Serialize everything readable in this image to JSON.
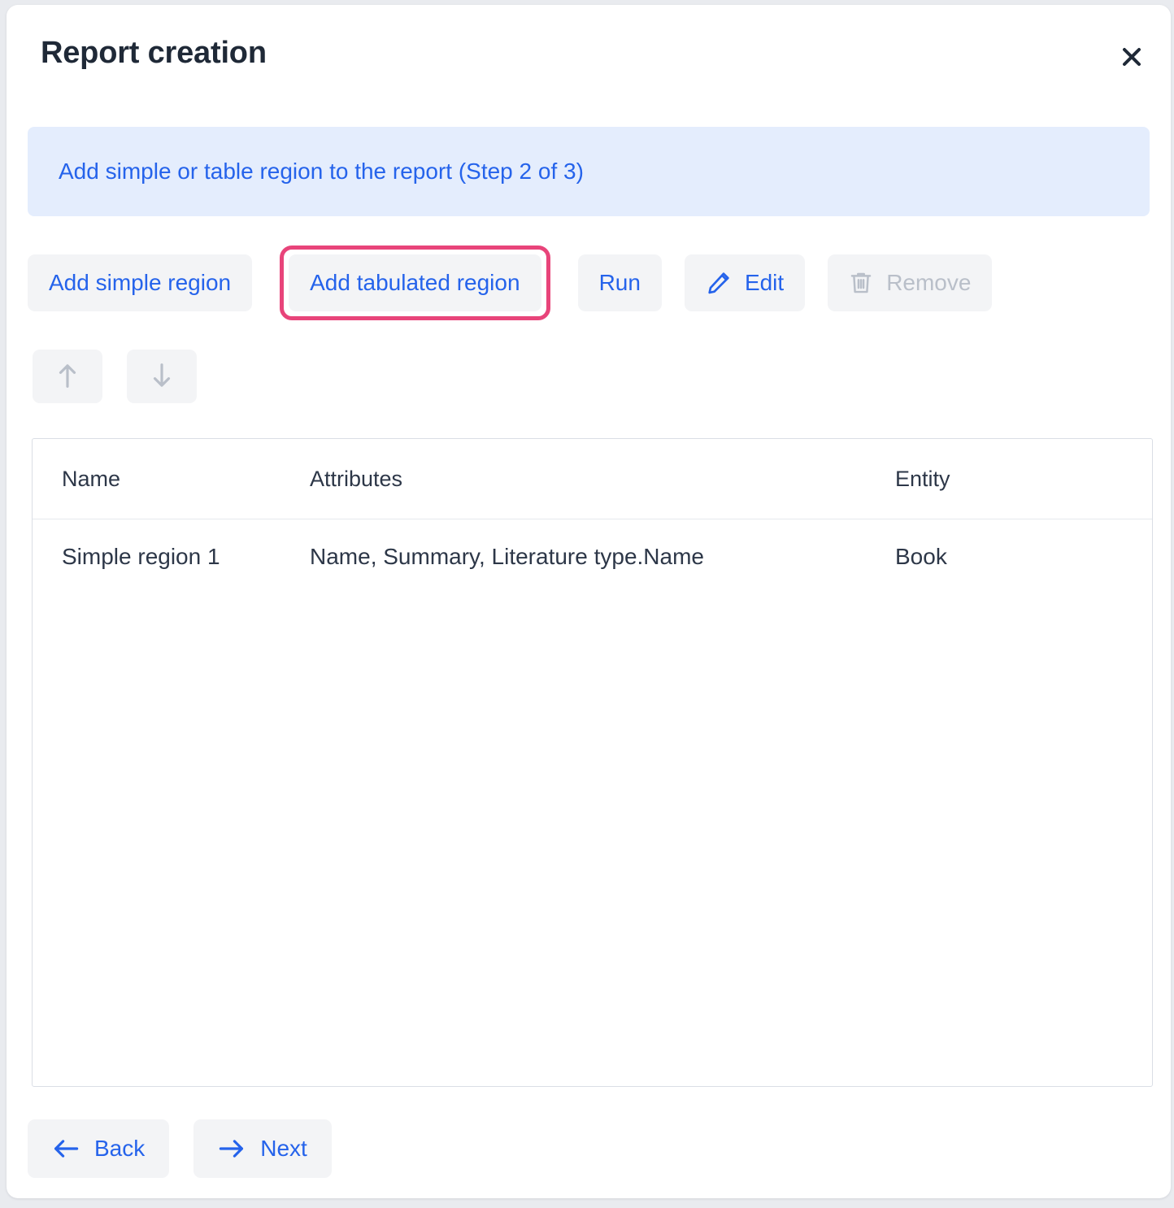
{
  "dialog": {
    "title": "Report creation",
    "close_label": "×",
    "close_icon": "close-icon"
  },
  "banner": {
    "text": "Add simple or table region to the report (Step 2 of 3)",
    "background_color": "#e4edfd",
    "text_color": "#2563eb"
  },
  "actions": {
    "add_simple_region": "Add simple region",
    "add_tabulated_region": "Add tabulated region",
    "run": "Run",
    "edit": "Edit",
    "edit_icon": "pencil-icon",
    "remove": "Remove",
    "remove_icon": "trash-icon",
    "highlighted": "Add tabulated region",
    "highlight_color": "#e8447a"
  },
  "reorder": {
    "move_up_icon": "arrow-up-icon",
    "move_down_icon": "arrow-down-icon"
  },
  "table": {
    "columns": [
      "Name",
      "Attributes",
      "Entity"
    ],
    "rows": [
      {
        "name": "Simple region 1",
        "attributes": "Name, Summary, Literature type.Name",
        "entity": "Book"
      }
    ]
  },
  "footer": {
    "back": "Back",
    "back_icon": "arrow-left-icon",
    "next": "Next",
    "next_icon": "arrow-right-icon"
  }
}
